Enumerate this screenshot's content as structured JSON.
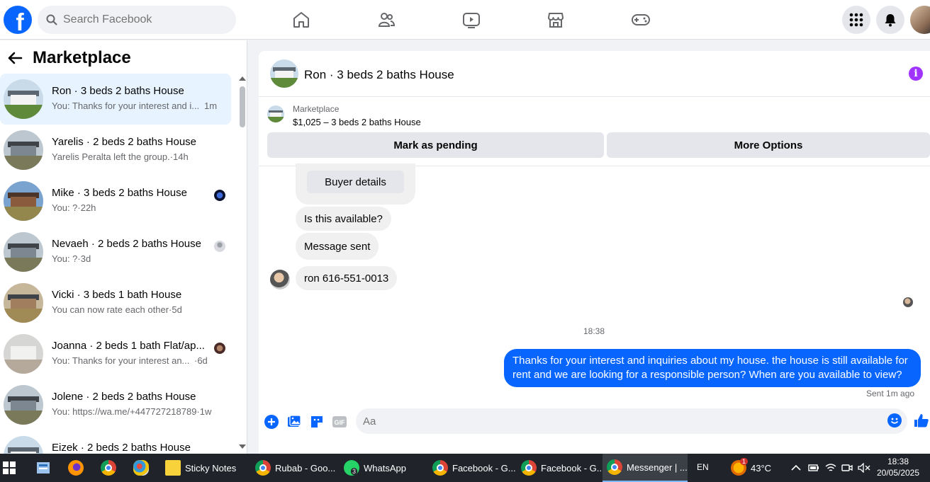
{
  "topbar": {
    "logo": "f",
    "search_placeholder": "Search Facebook",
    "nav_icons": [
      "home-icon",
      "friends-icon",
      "video-icon",
      "marketplace-icon",
      "gaming-icon"
    ]
  },
  "sidebar": {
    "title": "Marketplace",
    "conversations": [
      {
        "name": "Ron · 3 beds 2 baths House",
        "preview": "You: Thanks for your interest and i...",
        "time": "1m"
      },
      {
        "name": "Yarelis · 2 beds 2 baths House",
        "preview": "Yarelis Peralta left the group.·14h",
        "time": ""
      },
      {
        "name": "Mike · 3 beds 2 baths House",
        "preview": "You: ?·22h",
        "time": ""
      },
      {
        "name": "Nevaeh · 2 beds 2 baths House",
        "preview": "You: ?·3d",
        "time": ""
      },
      {
        "name": "Vicki · 3 beds 1 bath House",
        "preview": "You can now rate each other·5d",
        "time": ""
      },
      {
        "name": "Joanna · 2 beds 1 bath Flat/ap...",
        "preview": "You: Thanks for your interest an...",
        "time": "·6d"
      },
      {
        "name": "Jolene · 2 beds 2 baths House",
        "preview": "You: https://wa.me/+447727218789·1w",
        "time": ""
      },
      {
        "name": "Eizek · 2 beds 2 baths House",
        "preview": "",
        "time": ""
      }
    ]
  },
  "chat": {
    "title": "Ron · 3 beds 2 baths House",
    "listing_category": "Marketplace",
    "listing_desc": "$1,025 – 3 beds 2 baths House",
    "mark_pending": "Mark as pending",
    "more_options": "More Options",
    "buyer_details": "Buyer details",
    "messages": [
      {
        "text": "Is this available?"
      },
      {
        "text": "Message sent"
      },
      {
        "text": "ron 616-551-0013"
      }
    ],
    "timestamp": "18:38",
    "outgoing": "Thanks for your interest and inquiries about my house. the house is still available for rent and we are looking for a responsible person? When are you available to view?",
    "sent_status": "Sent 1m ago",
    "composer_placeholder": "Aa"
  },
  "taskbar": {
    "items": [
      {
        "label": "Sticky Notes"
      },
      {
        "label": "Rubab - Goo..."
      },
      {
        "label": "WhatsApp"
      },
      {
        "label": "Facebook - G..."
      },
      {
        "label": "Facebook - G..."
      },
      {
        "label": "Messenger | ..."
      }
    ],
    "whatsapp_badge": "3",
    "weather_badge": "1",
    "language": "EN",
    "temperature": "43°C",
    "time": "18:38",
    "date": "20/05/2025"
  },
  "colors": {
    "accent": "#0866ff",
    "info": "#a033ff",
    "active_conv": "#e7f3ff"
  }
}
